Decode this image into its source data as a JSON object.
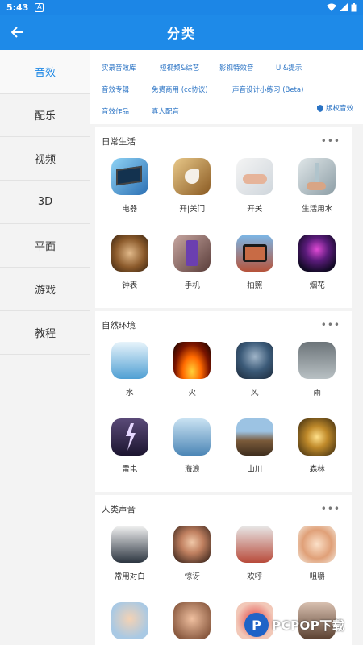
{
  "status_bar": {
    "time": "5:43"
  },
  "app_bar": {
    "title": "分类"
  },
  "sidebar": {
    "items": [
      {
        "label": "音效",
        "active": true
      },
      {
        "label": "配乐"
      },
      {
        "label": "视频"
      },
      {
        "label": "3D"
      },
      {
        "label": "平面"
      },
      {
        "label": "游戏"
      },
      {
        "label": "教程"
      }
    ]
  },
  "subtags": {
    "row1": [
      "实录音效库",
      "短视频&综艺",
      "影视特效音",
      "UI&提示"
    ],
    "row2": [
      "音效专辑",
      "免费商用 (cc协议)",
      "声音设计小练习 (Beta)"
    ],
    "row3": [
      "音效作品",
      "真人配音"
    ],
    "copyright_label": "版权音效"
  },
  "sections": [
    {
      "title": "日常生活",
      "more": "•••",
      "items": [
        "电器",
        "开|关门",
        "开关",
        "生活用水",
        "钟表",
        "手机",
        "拍照",
        "烟花"
      ]
    },
    {
      "title": "自然环境",
      "more": "•••",
      "items": [
        "水",
        "火",
        "风",
        "雨",
        "雷电",
        "海浪",
        "山川",
        "森林"
      ]
    },
    {
      "title": "人类声音",
      "more": "•••",
      "items": [
        "常用对白",
        "惊讶",
        "欢呼",
        "咀嚼",
        "",
        "",
        "",
        ""
      ]
    }
  ],
  "watermark": {
    "logo": "P",
    "text": "PCPOP下载"
  }
}
